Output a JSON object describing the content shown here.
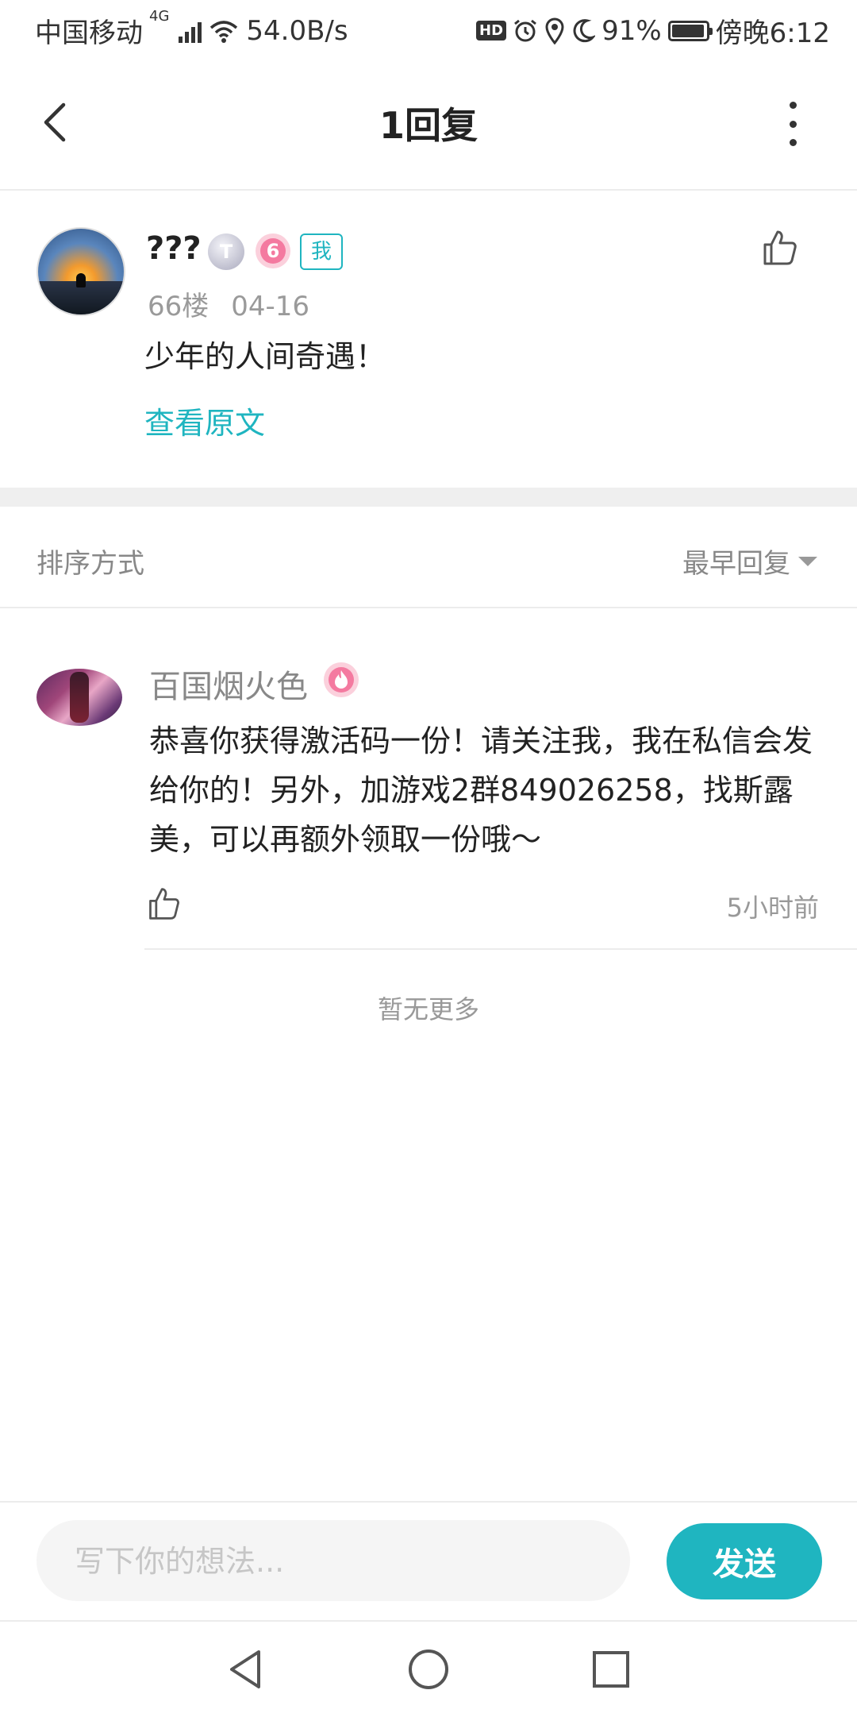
{
  "status_bar": {
    "carrier": "中国移动",
    "network": "4G",
    "speed": "54.0B/s",
    "hd": "HD",
    "battery": "91%",
    "time": "傍晚6:12"
  },
  "header": {
    "title": "1回复"
  },
  "post": {
    "username": "???",
    "badge_t": "T",
    "badge_level": "6",
    "me_tag": "我",
    "floor": "66楼",
    "date": "04-16",
    "content": "少年的人间奇遇！",
    "view_original": "查看原文"
  },
  "sort": {
    "label": "排序方式",
    "selected": "最早回复"
  },
  "reply": {
    "username": "百国烟火色",
    "content": "恭喜你获得激活码一份！请关注我，我在私信会发给你的！另外，加游戏2群849026258，找斯露美，可以再额外领取一份哦～",
    "time": "5小时前"
  },
  "no_more": "暂无更多",
  "input": {
    "placeholder": "写下你的想法...",
    "send_label": "发送"
  },
  "colors": {
    "accent": "#1fb5c0",
    "divider": "#ececec"
  }
}
